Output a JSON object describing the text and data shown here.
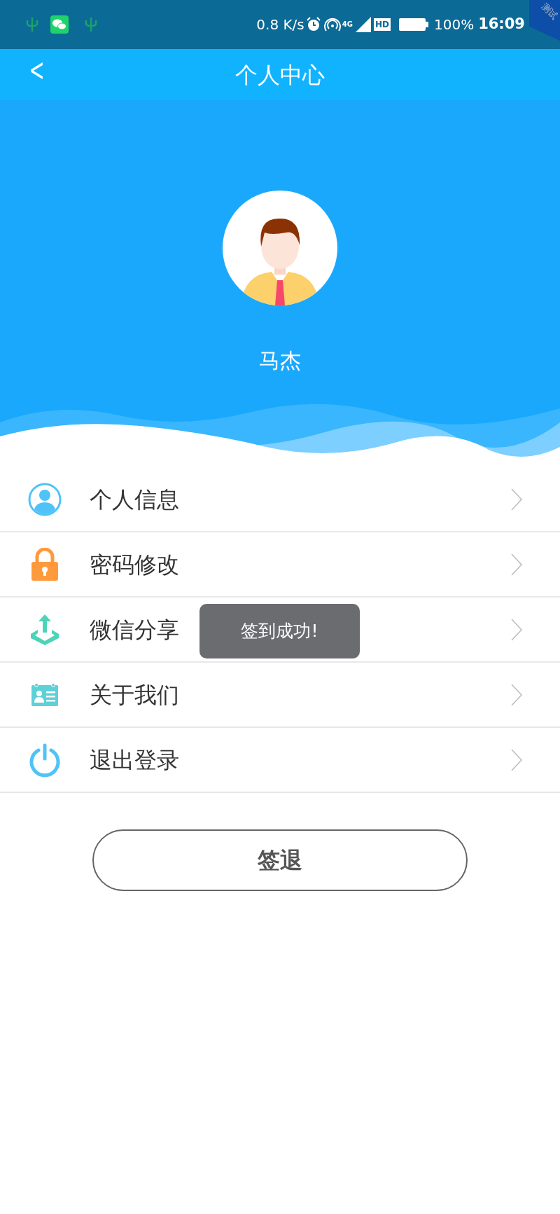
{
  "status_bar": {
    "speed": "0.8 K/s",
    "network_type": "4G",
    "hd_label": "HD",
    "battery": "100%",
    "time": "16:09"
  },
  "debug_ribbon": "测试",
  "header": {
    "back": "<",
    "title": "个人中心"
  },
  "profile": {
    "name": "马杰"
  },
  "menu": [
    {
      "kind": "person",
      "label": "个人信息"
    },
    {
      "kind": "lock",
      "label": "密码修改"
    },
    {
      "kind": "share",
      "label": "微信分享"
    },
    {
      "kind": "card",
      "label": "关于我们"
    },
    {
      "kind": "power",
      "label": "退出登录"
    }
  ],
  "toast": "签到成功!",
  "sign_out_button": "签退"
}
